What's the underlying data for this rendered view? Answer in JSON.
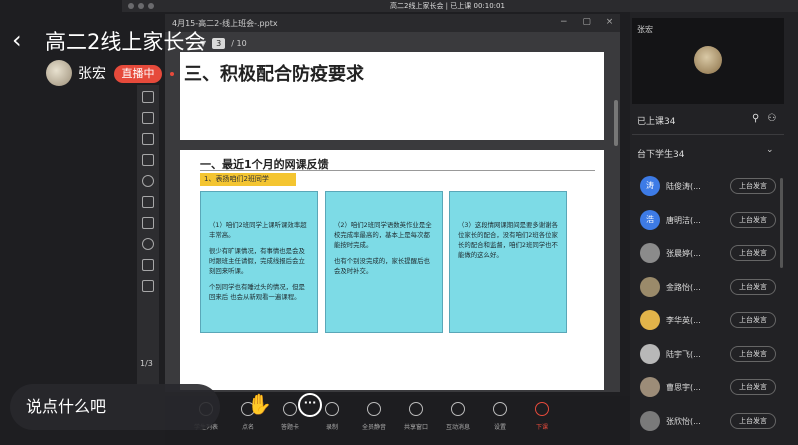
{
  "window": {
    "title": "高二2线上家长会 | 已上课 00:10:01"
  },
  "viewer": {
    "back_icon": "chevron-left-icon",
    "room_title": "高二2线上家长会",
    "host_name": "张宏",
    "live_badge": "直播中",
    "comment_placeholder": "说点什么吧"
  },
  "ppt": {
    "file_title": "4月15-高二2-线上班会-.pptx",
    "page_input": "3",
    "page_total": "/ 10",
    "page_count": "1/3",
    "slide1_title": "三、积极配合防疫要求",
    "slide2_title": "一、最近1个月的网课反馈",
    "slide2_subtitle": "1、表扬咱们2班同学",
    "cards": [
      {
        "p1": "（1）咱们2班同学上课听课效率超丰常高。",
        "p2": "很少有旷课情况，有事情也是会及时跟班主任请假，完成线报后会立刻回来听课。",
        "p3": "个别同学也有睡过头的情况，但是回来后 也会从新观看一遍课程。"
      },
      {
        "p1": "（2）咱们2班同学语数英作业是全校完成率最高的，基本上是每次都能按时完成。",
        "p2": "也有个别没完成的，家长提醒后也会及时补交。",
        "p3": ""
      },
      {
        "p1": "（3）这段情网课期间是要多谢谢各位家长的配合，没有咱们2班各位家长的配合和监督，咱们2班同学也不能做的这么好。",
        "p2": "",
        "p3": ""
      }
    ]
  },
  "panel": {
    "teacher_name": "张宏",
    "online_header": "已上课34",
    "offline_header": "台下学生34",
    "students": [
      {
        "avatar": "涛",
        "name": "陆俊涛(...",
        "action": "上台发言",
        "color": "#3d7be6"
      },
      {
        "avatar": "浩",
        "name": "唐明洁(...",
        "action": "上台发言",
        "color": "#3d7be6"
      },
      {
        "avatar": "",
        "name": "张晨婷(...",
        "action": "上台发言",
        "color": "#8b8b8b"
      },
      {
        "avatar": "",
        "name": "金路怡(...",
        "action": "上台发言",
        "color": "#9a8a6a"
      },
      {
        "avatar": "",
        "name": "李华英(...",
        "action": "上台发言",
        "color": "#e2b44a"
      },
      {
        "avatar": "",
        "name": "陆宇飞(...",
        "action": "上台发言",
        "color": "#b8b8b8"
      },
      {
        "avatar": "",
        "name": "曹思宇(...",
        "action": "上台发言",
        "color": "#9c8c78"
      },
      {
        "avatar": "",
        "name": "张欣怡(...",
        "action": "上台发言",
        "color": "#7a7a7a"
      }
    ]
  },
  "toolbar": {
    "items": [
      "学生列表",
      "点名",
      "答题卡",
      "录制",
      "全员静音",
      "共享窗口",
      "互动消息",
      "设置",
      "下课"
    ]
  }
}
